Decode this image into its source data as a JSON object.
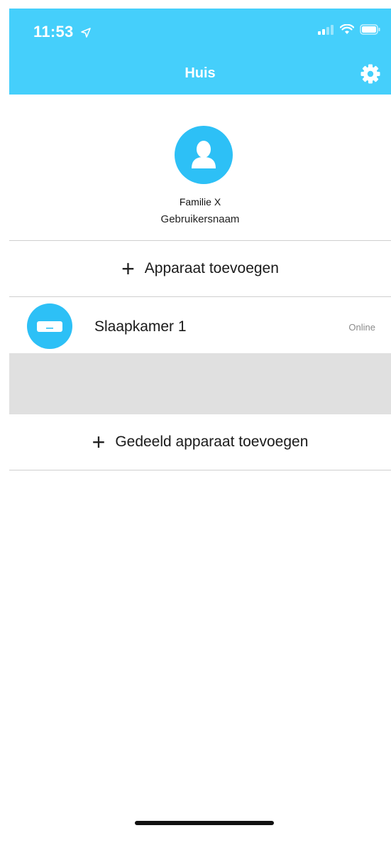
{
  "status_bar": {
    "time": "11:53"
  },
  "header": {
    "title": "Huis",
    "background_color": "#45CFFB"
  },
  "profile": {
    "name": "Familie X",
    "username": "Gebruikersnaam"
  },
  "actions": {
    "add_device_label": "Apparaat toevoegen",
    "add_shared_device_label": "Gedeeld apparaat toevoegen"
  },
  "devices": [
    {
      "name": "Slaapkamer 1",
      "status": "Online",
      "icon": "air-conditioner-icon"
    }
  ],
  "colors": {
    "accent": "#2DC0F6",
    "divider": "#cfcfcf",
    "band": "#e0e0e0"
  }
}
